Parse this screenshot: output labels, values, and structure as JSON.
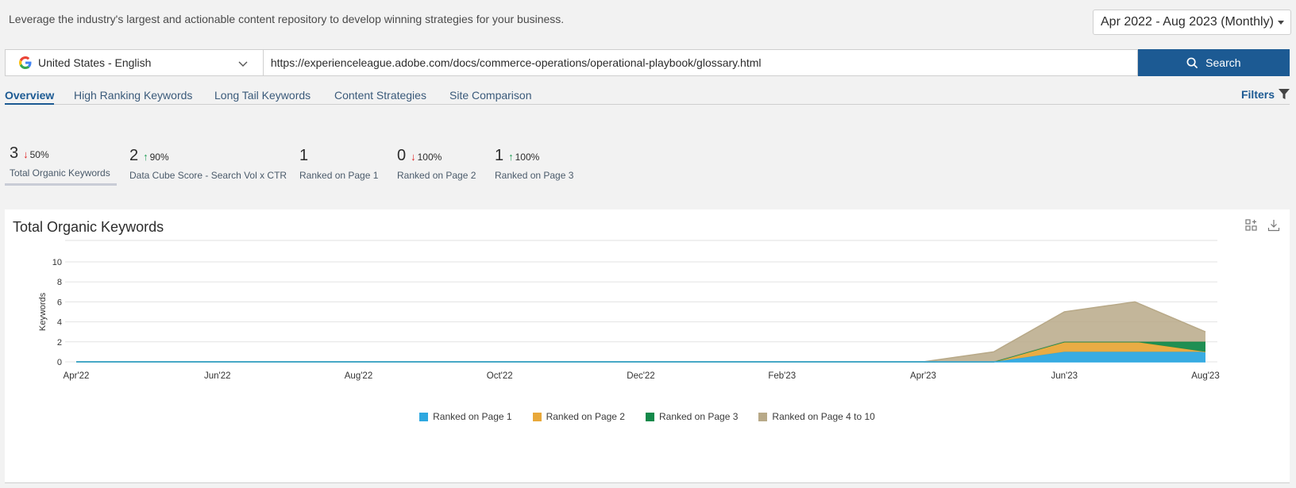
{
  "header": {
    "tagline": "Leverage the industry's largest and actionable content repository to develop winning strategies for your business.",
    "date_range": "Apr 2022 - Aug 2023 (Monthly)"
  },
  "search": {
    "locale": "United States - English",
    "url": "https://experienceleague.adobe.com/docs/commerce-operations/operational-playbook/glossary.html",
    "button_label": "Search"
  },
  "tabs": [
    {
      "label": "Overview",
      "active": true
    },
    {
      "label": "High Ranking Keywords"
    },
    {
      "label": "Long Tail Keywords"
    },
    {
      "label": "Content Strategies"
    },
    {
      "label": "Site Comparison"
    }
  ],
  "filters_label": "Filters",
  "kpis": [
    {
      "value": "3",
      "change": "50%",
      "direction": "down",
      "label": "Total Organic Keywords",
      "active": true
    },
    {
      "value": "2",
      "change": "90%",
      "direction": "up",
      "label": "Data Cube Score - Search Vol x CTR"
    },
    {
      "value": "1",
      "change": "",
      "direction": "",
      "label": "Ranked on Page 1"
    },
    {
      "value": "0",
      "change": "100%",
      "direction": "down",
      "label": "Ranked on Page 2"
    },
    {
      "value": "1",
      "change": "100%",
      "direction": "up",
      "label": "Ranked on Page 3"
    }
  ],
  "chart_card": {
    "title": "Total Organic Keywords"
  },
  "colors": {
    "accent": "#1c5a93",
    "down": "#e02020",
    "up": "#1f9d55"
  },
  "chart_data": {
    "type": "area",
    "stacked": true,
    "title": "Total Organic Keywords",
    "xlabel": "",
    "ylabel": "Keywords",
    "ylim": [
      0,
      10
    ],
    "yticks": [
      0,
      2,
      4,
      6,
      8,
      10
    ],
    "x": [
      "Apr'22",
      "May'22",
      "Jun'22",
      "Jul'22",
      "Aug'22",
      "Sep'22",
      "Oct'22",
      "Nov'22",
      "Dec'22",
      "Jan'23",
      "Feb'23",
      "Mar'23",
      "Apr'23",
      "May'23",
      "Jun'23",
      "Jul'23",
      "Aug'23"
    ],
    "xtick_labels": [
      "Apr'22",
      "Jun'22",
      "Aug'22",
      "Oct'22",
      "Dec'22",
      "Feb'23",
      "Apr'23",
      "Jun'23",
      "Aug'23"
    ],
    "series": [
      {
        "name": "Ranked on Page 1",
        "color": "#2ea8e0",
        "values": [
          0,
          0,
          0,
          0,
          0,
          0,
          0,
          0,
          0,
          0,
          0,
          0,
          0,
          0,
          1,
          1,
          1
        ]
      },
      {
        "name": "Ranked on Page 2",
        "color": "#e8a83a",
        "values": [
          0,
          0,
          0,
          0,
          0,
          0,
          0,
          0,
          0,
          0,
          0,
          0,
          0,
          0,
          1,
          1,
          0
        ]
      },
      {
        "name": "Ranked on Page 3",
        "color": "#13894a",
        "values": [
          0,
          0,
          0,
          0,
          0,
          0,
          0,
          0,
          0,
          0,
          0,
          0,
          0,
          0,
          0,
          0,
          1
        ]
      },
      {
        "name": "Ranked on Page 4 to 10",
        "color": "#b8a988",
        "values": [
          0,
          0,
          0,
          0,
          0,
          0,
          0,
          0,
          0,
          0,
          0,
          0,
          0,
          1,
          3,
          4,
          1
        ]
      }
    ],
    "grid": true,
    "legend_position": "bottom"
  }
}
